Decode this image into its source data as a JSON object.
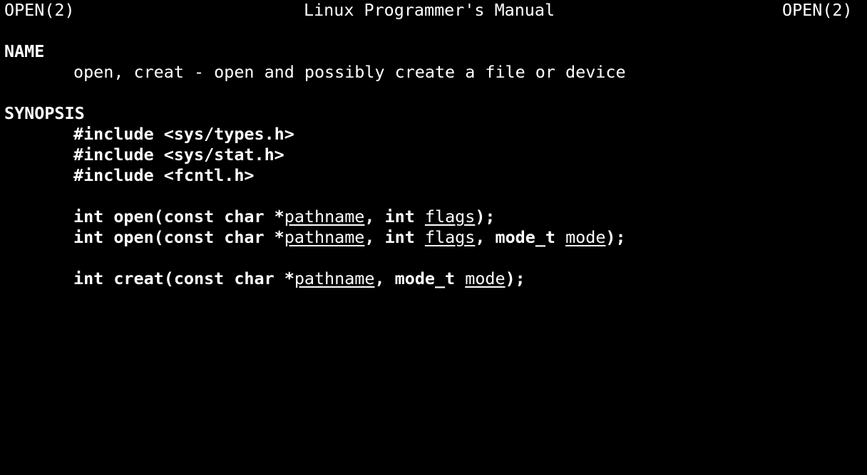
{
  "header": {
    "left": "OPEN(2)",
    "center": "Linux Programmer's Manual",
    "right": "OPEN(2)"
  },
  "name_section": {
    "heading": "NAME",
    "description": "open, creat - open and possibly create a file or device"
  },
  "synopsis_section": {
    "heading": "SYNOPSIS",
    "includes": [
      "#include <sys/types.h>",
      "#include <sys/stat.h>",
      "#include <fcntl.h>"
    ],
    "prototype1": {
      "p1": "int open(const char *",
      "arg1": "pathname",
      "p2": ", int ",
      "arg2": "flags",
      "p3": ");"
    },
    "prototype2": {
      "p1": "int open(const char *",
      "arg1": "pathname",
      "p2": ", int ",
      "arg2": "flags",
      "p3": ", mode_t ",
      "arg3": "mode",
      "p4": ");"
    },
    "prototype3": {
      "p1": "int creat(const char *",
      "arg1": "pathname",
      "p2": ", mode_t ",
      "arg2": "mode",
      "p3": ");"
    }
  },
  "colors": {
    "background": "#000000",
    "foreground": "#ffffff"
  }
}
